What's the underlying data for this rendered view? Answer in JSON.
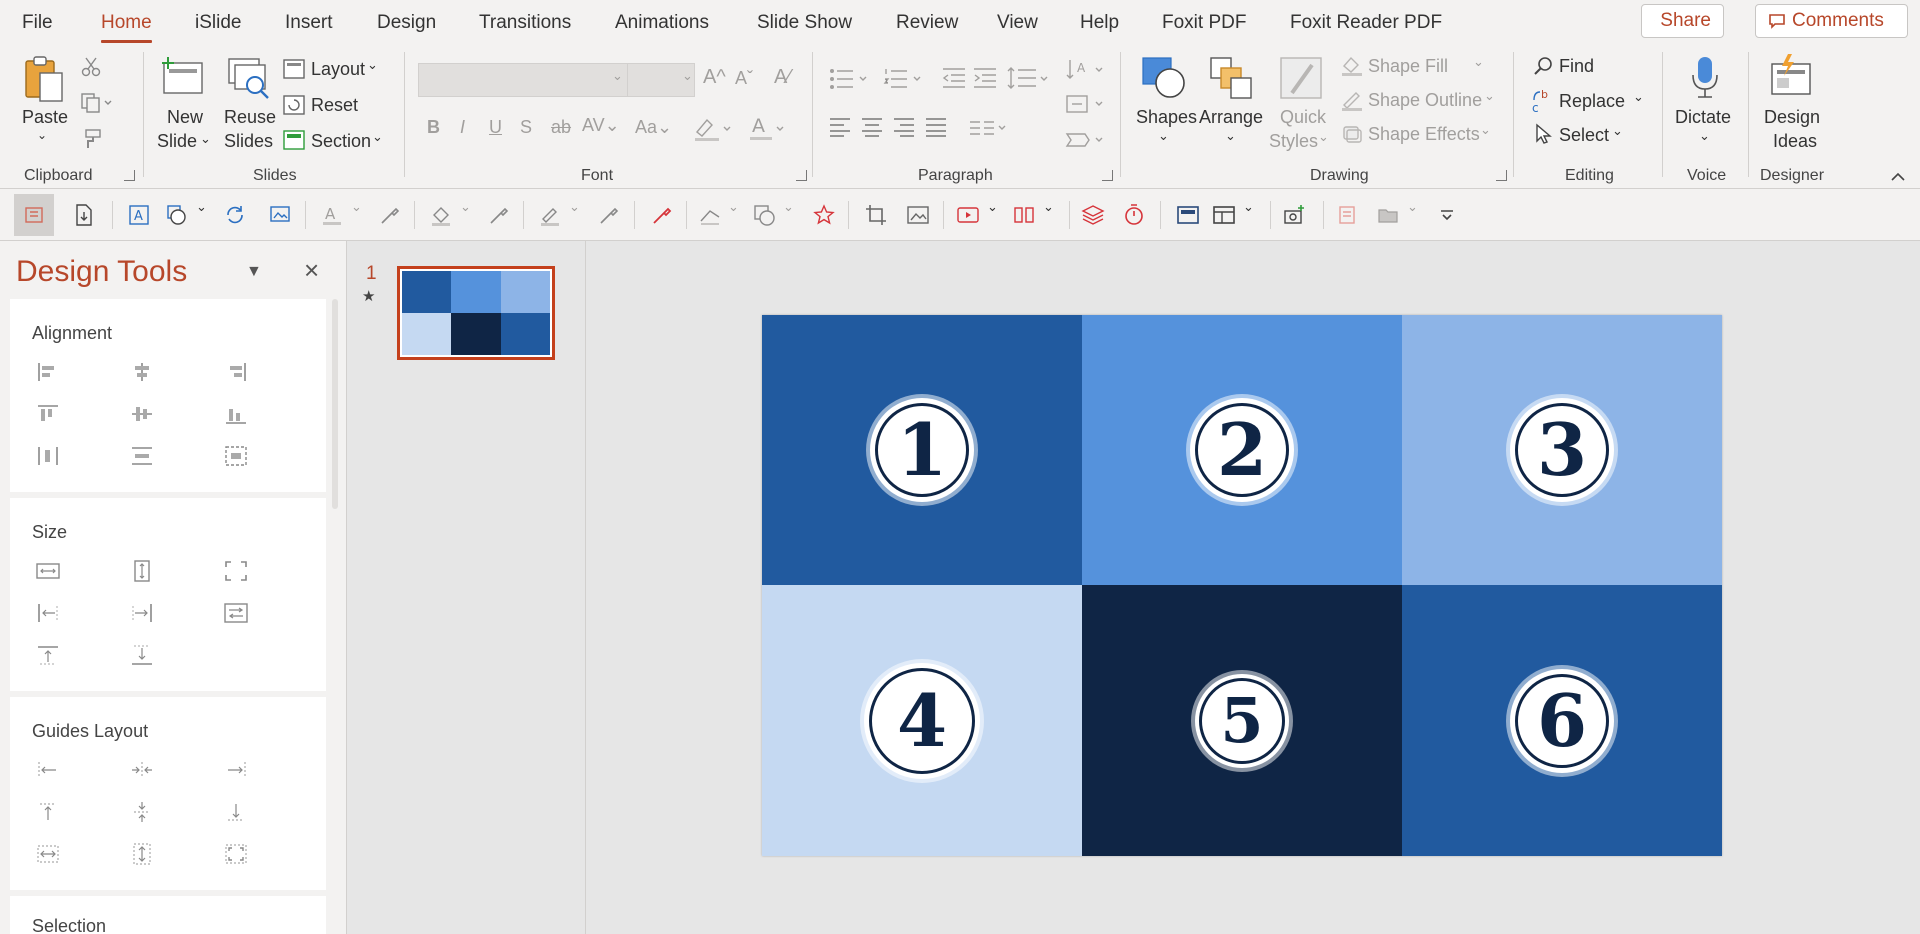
{
  "menu": {
    "tabs": [
      {
        "label": "File"
      },
      {
        "label": "Home"
      },
      {
        "label": "iSlide"
      },
      {
        "label": "Insert"
      },
      {
        "label": "Design"
      },
      {
        "label": "Transitions"
      },
      {
        "label": "Animations"
      },
      {
        "label": "Slide Show"
      },
      {
        "label": "Review"
      },
      {
        "label": "View"
      },
      {
        "label": "Help"
      },
      {
        "label": "Foxit PDF"
      },
      {
        "label": "Foxit Reader PDF"
      }
    ],
    "active_tab": "Home",
    "share_label": "Share",
    "comments_label": "Comments"
  },
  "ribbon": {
    "clipboard": {
      "label": "Clipboard",
      "paste": "Paste"
    },
    "slides": {
      "label": "Slides",
      "new_slide_1": "New",
      "new_slide_2": "Slide",
      "reuse_1": "Reuse",
      "reuse_2": "Slides",
      "layout": "Layout",
      "reset": "Reset",
      "section": "Section"
    },
    "font": {
      "label": "Font"
    },
    "paragraph": {
      "label": "Paragraph"
    },
    "drawing": {
      "label": "Drawing",
      "shapes": "Shapes",
      "arrange": "Arrange",
      "quick_1": "Quick",
      "quick_2": "Styles",
      "shape_fill": "Shape Fill",
      "shape_outline": "Shape Outline",
      "shape_effects": "Shape Effects"
    },
    "editing": {
      "label": "Editing",
      "find": "Find",
      "replace": "Replace",
      "select": "Select"
    },
    "voice": {
      "label": "Voice",
      "dictate": "Dictate"
    },
    "designer": {
      "label": "Designer",
      "ideas_1": "Design",
      "ideas_2": "Ideas"
    }
  },
  "pane": {
    "title": "Design Tools",
    "sections": [
      {
        "label": "Alignment"
      },
      {
        "label": "Size"
      },
      {
        "label": "Guides Layout"
      },
      {
        "label": "Selection"
      }
    ]
  },
  "thumbnails": [
    {
      "number": "1",
      "star": "★"
    }
  ],
  "slide": {
    "cells": [
      {
        "number": "1",
        "color": "#215a9f"
      },
      {
        "number": "2",
        "color": "#5592dc"
      },
      {
        "number": "3",
        "color": "#8db4e7"
      },
      {
        "number": "4",
        "color": "#c5d9f2"
      },
      {
        "number": "5",
        "color": "#0f2545"
      },
      {
        "number": "6",
        "color": "#215a9f"
      }
    ]
  },
  "colors": {
    "accent": "#b7472a",
    "navy": "#0f2545"
  }
}
